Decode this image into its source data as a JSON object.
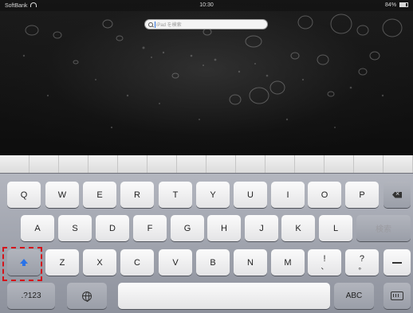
{
  "status_bar": {
    "carrier": "SoftBank",
    "time": "10:30",
    "battery": "84%"
  },
  "search": {
    "placeholder": "iPad を検索"
  },
  "keyboard": {
    "row1": [
      "Q",
      "W",
      "E",
      "R",
      "T",
      "Y",
      "U",
      "I",
      "O",
      "P"
    ],
    "row2": [
      "A",
      "S",
      "D",
      "F",
      "G",
      "H",
      "J",
      "K",
      "L"
    ],
    "row3": [
      "Z",
      "X",
      "C",
      "V",
      "B",
      "N",
      "M"
    ],
    "return_label": "検索",
    "numbers_label": ".?123",
    "abc_label": "ABC",
    "excl": {
      "top": "!",
      "bottom": "、"
    },
    "question": {
      "top": "?",
      "bottom": "。"
    }
  },
  "colors": {
    "shift_highlight": "#d4141b",
    "shift_arrow": "#2a73e8"
  },
  "icons": [
    "wifi-icon",
    "battery-icon",
    "search-icon",
    "shift-icon",
    "backspace-icon",
    "globe-icon",
    "keyboard-dismiss-icon"
  ]
}
